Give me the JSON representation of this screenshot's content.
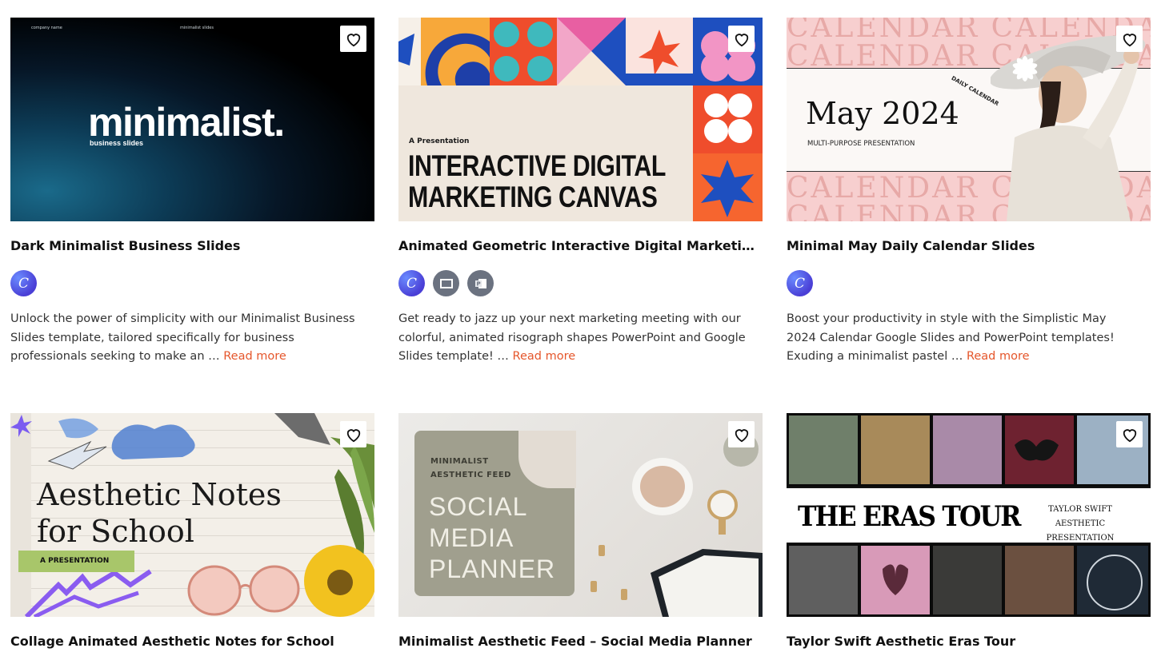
{
  "cards": [
    {
      "title": "Dark Minimalist Business Slides",
      "description": "Unlock the power of simplicity with our Minimalist Business Slides template, tailored specifically for business professionals seeking to make an … ",
      "read_more": "Read more",
      "thumb": {
        "small_left": "company name",
        "small_right": "minimalist slides",
        "headline": "minimalist.",
        "subline": "business slides"
      },
      "badges": [
        "canva-icon"
      ]
    },
    {
      "title": "Animated Geometric Interactive Digital Marketing Ca…",
      "description": "Get ready to jazz up your next marketing meeting with our colorful, animated risograph shapes PowerPoint and Google Slides template! … ",
      "read_more": "Read more",
      "thumb": {
        "kicker": "A Presentation",
        "headline_line1": "INTERACTIVE DIGITAL",
        "headline_line2": "MARKETING CANVAS"
      },
      "badges": [
        "canva-icon",
        "google-slides-icon",
        "powerpoint-icon"
      ]
    },
    {
      "title": "Minimal May Daily Calendar Slides",
      "description": "Boost your productivity in style with the Simplistic May 2024 Calendar Google Slides and PowerPoint templates! Exuding a minimalist pastel … ",
      "read_more": "Read more",
      "thumb": {
        "pattern": "CALENDAR CALENDAR",
        "headline": "May 2024",
        "subline": "MULTI-PURPOSE PRESENTATION",
        "arc": "DAILY CALENDAR"
      },
      "badges": [
        "canva-icon"
      ]
    },
    {
      "title": "Collage Animated Aesthetic Notes for School",
      "thumb": {
        "line1": "Aesthetic Notes",
        "line2": "for School",
        "tag": "A PRESENTATION"
      }
    },
    {
      "title": "Minimalist Aesthetic Feed – Social Media Planner",
      "thumb": {
        "mini1": "MINIMALIST",
        "mini2": "AESTHETIC FEED",
        "big1": "SOCIAL",
        "big2": "MEDIA",
        "big3": "PLANNER"
      }
    },
    {
      "title": "Taylor Swift Aesthetic Eras Tour",
      "thumb": {
        "headline": "THE ERAS TOUR",
        "sub1": "TAYLOR SWIFT",
        "sub2": "AESTHETIC PRESENTATION"
      }
    }
  ],
  "icons": {
    "favorite": "heart-outline-icon"
  },
  "colors": {
    "read_more": "#e5562b",
    "canva_badge": "#5b5bf0",
    "format_badge": "#6b7280"
  }
}
